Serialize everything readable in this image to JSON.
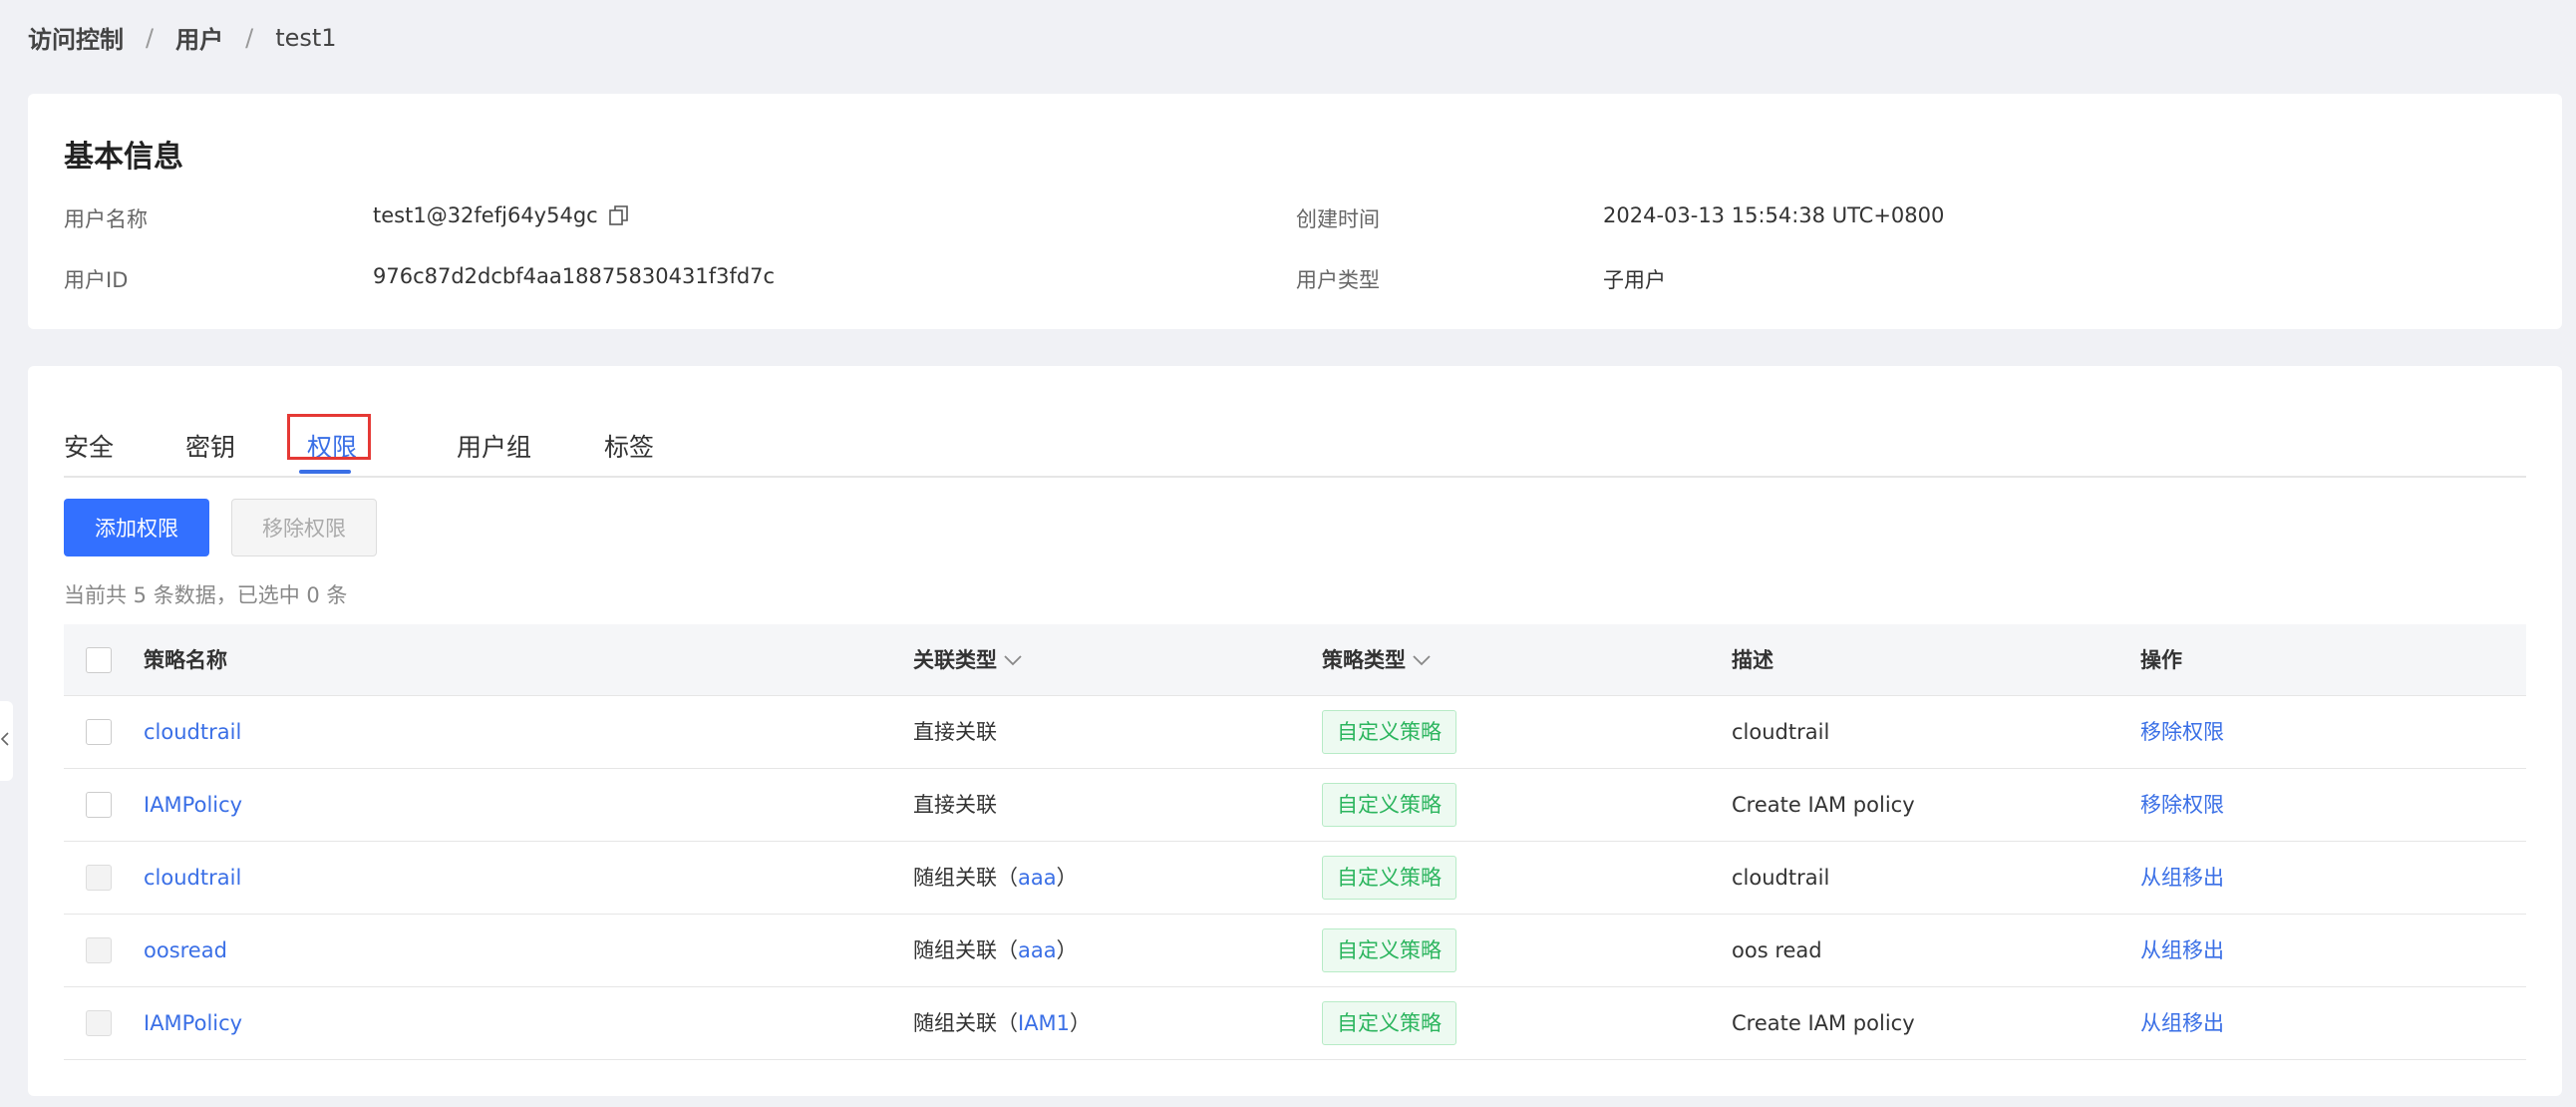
{
  "breadcrumb": {
    "item1": "访问控制",
    "item2": "用户",
    "current": "test1",
    "separator": "/"
  },
  "basic_info": {
    "title": "基本信息",
    "username_label": "用户名称",
    "username_value": "test1@32fefj64y54gc",
    "userid_label": "用户ID",
    "userid_value": "976c87d2dcbf4aa18875830431f3fd7c",
    "created_label": "创建时间",
    "created_value": "2024-03-13 15:54:38 UTC+0800",
    "usertype_label": "用户类型",
    "usertype_value": "子用户"
  },
  "tabs": [
    {
      "label": "安全"
    },
    {
      "label": "密钥"
    },
    {
      "label": "权限"
    },
    {
      "label": "用户组"
    },
    {
      "label": "标签"
    }
  ],
  "active_tab": "权限",
  "actions": {
    "add_label": "添加权限",
    "remove_label": "移除权限"
  },
  "summary": "当前共 5 条数据，已选中 0 条",
  "table": {
    "headers": {
      "name": "策略名称",
      "relation": "关联类型",
      "policy_type": "策略类型",
      "description": "描述",
      "operation": "操作"
    },
    "rows": [
      {
        "name": "cloudtrail",
        "relation": "直接关联",
        "group": "",
        "policy_type": "自定义策略",
        "description": "cloudtrail",
        "operation": "移除权限"
      },
      {
        "name": "IAMPolicy",
        "relation": "直接关联",
        "group": "",
        "policy_type": "自定义策略",
        "description": "Create IAM policy",
        "operation": "移除权限"
      },
      {
        "name": "cloudtrail",
        "relation": "随组关联（",
        "group": "aaa",
        "policy_type": "自定义策略",
        "description": "cloudtrail",
        "operation": "从组移出"
      },
      {
        "name": "oosread",
        "relation": "随组关联（",
        "group": "aaa",
        "policy_type": "自定义策略",
        "description": "oos read",
        "operation": "从组移出"
      },
      {
        "name": "IAMPolicy",
        "relation": "随组关联（",
        "group": "IAM1",
        "policy_type": "自定义策略",
        "description": "Create IAM policy",
        "operation": "从组移出"
      }
    ],
    "close_paren": "）"
  },
  "colors": {
    "accent": "#3370ff",
    "link": "#3a6fe6",
    "tag_green": "#2cb55e",
    "highlight_red": "#e53935"
  }
}
